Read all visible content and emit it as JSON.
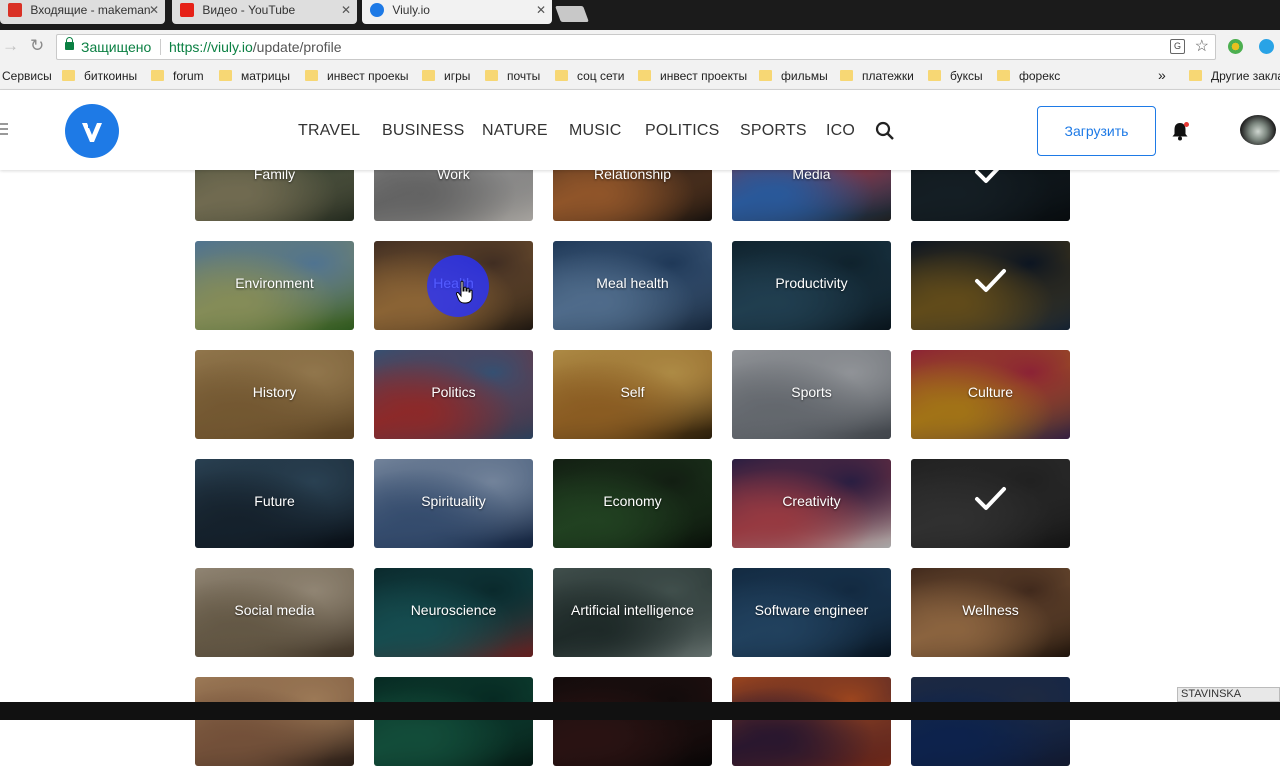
{
  "browser": {
    "tabs": [
      {
        "label": "Входящие - makeman",
        "favicon_color": "#d93025"
      },
      {
        "label": "Видео - YouTube",
        "favicon_color": "#e62117"
      },
      {
        "label": "Viuly.io",
        "favicon_color": "#1e7ae6"
      }
    ],
    "secure_label": "Защищено",
    "url_scheme_host": "https://viuly.io",
    "url_path": "/update/profile",
    "bookmarks": [
      "Сервисы",
      "биткоины",
      "forum",
      "матрицы",
      "инвест проекы",
      "игры",
      "почты",
      "соц сети",
      "инвест проекты",
      "фильмы",
      "платежки",
      "буксы",
      "форекс"
    ],
    "other_bookmarks": "Другие закладки",
    "overflow_glyph": "»"
  },
  "site": {
    "nav": [
      "TRAVEL",
      "BUSINESS",
      "NATURE",
      "MUSIC",
      "POLITICS",
      "SPORTS",
      "ICO"
    ],
    "upload_label": "Загрузить",
    "brand_color": "#1e7ae6",
    "icons": [
      "menu-icon",
      "viuly-logo",
      "search-icon",
      "bell-icon",
      "avatar"
    ]
  },
  "categories": [
    [
      {
        "label": "Family",
        "selected": false,
        "colors": [
          "#4b5a45",
          "#9c9470",
          "#2f3a2a"
        ]
      },
      {
        "label": "Work",
        "selected": false,
        "colors": [
          "#cfcfcf",
          "#8a8a8a",
          "#e6e2dc"
        ]
      },
      {
        "label": "Relationship",
        "selected": false,
        "colors": [
          "#3a2a22",
          "#c7763a",
          "#1d1714"
        ]
      },
      {
        "label": "Media",
        "selected": false,
        "colors": [
          "#d63b3b",
          "#3a7bd5",
          "#2b2b2b"
        ]
      },
      {
        "label": "",
        "selected": true,
        "colors": [
          "#1c2a33",
          "#2e4350",
          "#111a20"
        ]
      }
    ],
    [
      {
        "label": "Environment",
        "selected": false,
        "colors": [
          "#6fa0c8",
          "#b8c27a",
          "#3f7a2a"
        ]
      },
      {
        "label": "Health",
        "selected": false,
        "colors": [
          "#5a4030",
          "#c08a4a",
          "#2a2018"
        ]
      },
      {
        "label": "Meal health",
        "selected": false,
        "colors": [
          "#2c4f7a",
          "#6e95c0",
          "#1d3450"
        ]
      },
      {
        "label": "Productivity",
        "selected": false,
        "colors": [
          "#16303f",
          "#2d566e",
          "#0d1c26"
        ]
      },
      {
        "label": "",
        "selected": true,
        "colors": [
          "#1c2f4a",
          "#d6a63a",
          "#2c4a6e"
        ]
      }
    ],
    [
      {
        "label": "History",
        "selected": false,
        "colors": [
          "#c9a46a",
          "#a07a45",
          "#7a5a30"
        ]
      },
      {
        "label": "Politics",
        "selected": false,
        "colors": [
          "#4a6f9e",
          "#c23a3a",
          "#3a5a80"
        ]
      },
      {
        "label": "Self",
        "selected": false,
        "colors": [
          "#f0c060",
          "#c08030",
          "#3a2a10"
        ]
      },
      {
        "label": "Sports",
        "selected": false,
        "colors": [
          "#c8ccd2",
          "#8a9098",
          "#5a6068"
        ]
      },
      {
        "label": "Culture",
        "selected": false,
        "colors": [
          "#c2304a",
          "#e0a020",
          "#4a2a5a"
        ]
      }
    ],
    [
      {
        "label": "Future",
        "selected": false,
        "colors": [
          "#3a5a72",
          "#1e2f3e",
          "#0d1620"
        ]
      },
      {
        "label": "Spirituality",
        "selected": false,
        "colors": [
          "#9fb6d6",
          "#4a6a98",
          "#1e3458"
        ]
      },
      {
        "label": "Economy",
        "selected": false,
        "colors": [
          "#1a2a1a",
          "#2e5a2e",
          "#0c140c"
        ]
      },
      {
        "label": "Creativity",
        "selected": false,
        "colors": [
          "#3a2a5a",
          "#d0505a",
          "#e8e8e8"
        ]
      },
      {
        "label": "",
        "selected": true,
        "colors": [
          "#4a4a4a",
          "#6a6a6a",
          "#2a2a2a"
        ]
      }
    ],
    [
      {
        "label": "Social media",
        "selected": false,
        "colors": [
          "#c8b8a0",
          "#8a7a60",
          "#5a4a38"
        ]
      },
      {
        "label": "Neuroscience",
        "selected": false,
        "colors": [
          "#0f3a3e",
          "#1f6a6e",
          "#8a2a2a"
        ]
      },
      {
        "label": "Artificial intelligence",
        "selected": false,
        "colors": [
          "#5a6e6a",
          "#2a3a38",
          "#8a9a96"
        ]
      },
      {
        "label": "Software engineer",
        "selected": false,
        "colors": [
          "#1a3a5a",
          "#2e5a82",
          "#0a1a2a"
        ]
      },
      {
        "label": "Wellness",
        "selected": false,
        "colors": [
          "#5a3a28",
          "#c08a58",
          "#2a1a10"
        ]
      }
    ],
    [
      {
        "label": "",
        "selected": false,
        "colors": [
          "#d8a878",
          "#a07050",
          "#3a2a20"
        ]
      },
      {
        "label": "",
        "selected": false,
        "colors": [
          "#0a3a30",
          "#1a6a50",
          "#06201a"
        ]
      },
      {
        "label": "",
        "selected": false,
        "colors": [
          "#1a1010",
          "#3a1a1a",
          "#0a0808"
        ]
      },
      {
        "label": "",
        "selected": false,
        "colors": [
          "#d8602a",
          "#3a2040",
          "#a03a20"
        ]
      },
      {
        "label": "",
        "selected": false,
        "colors": [
          "#2a3a5a",
          "#12306a",
          "#1a2440"
        ]
      }
    ]
  ],
  "watermark": "STAVINSKA"
}
